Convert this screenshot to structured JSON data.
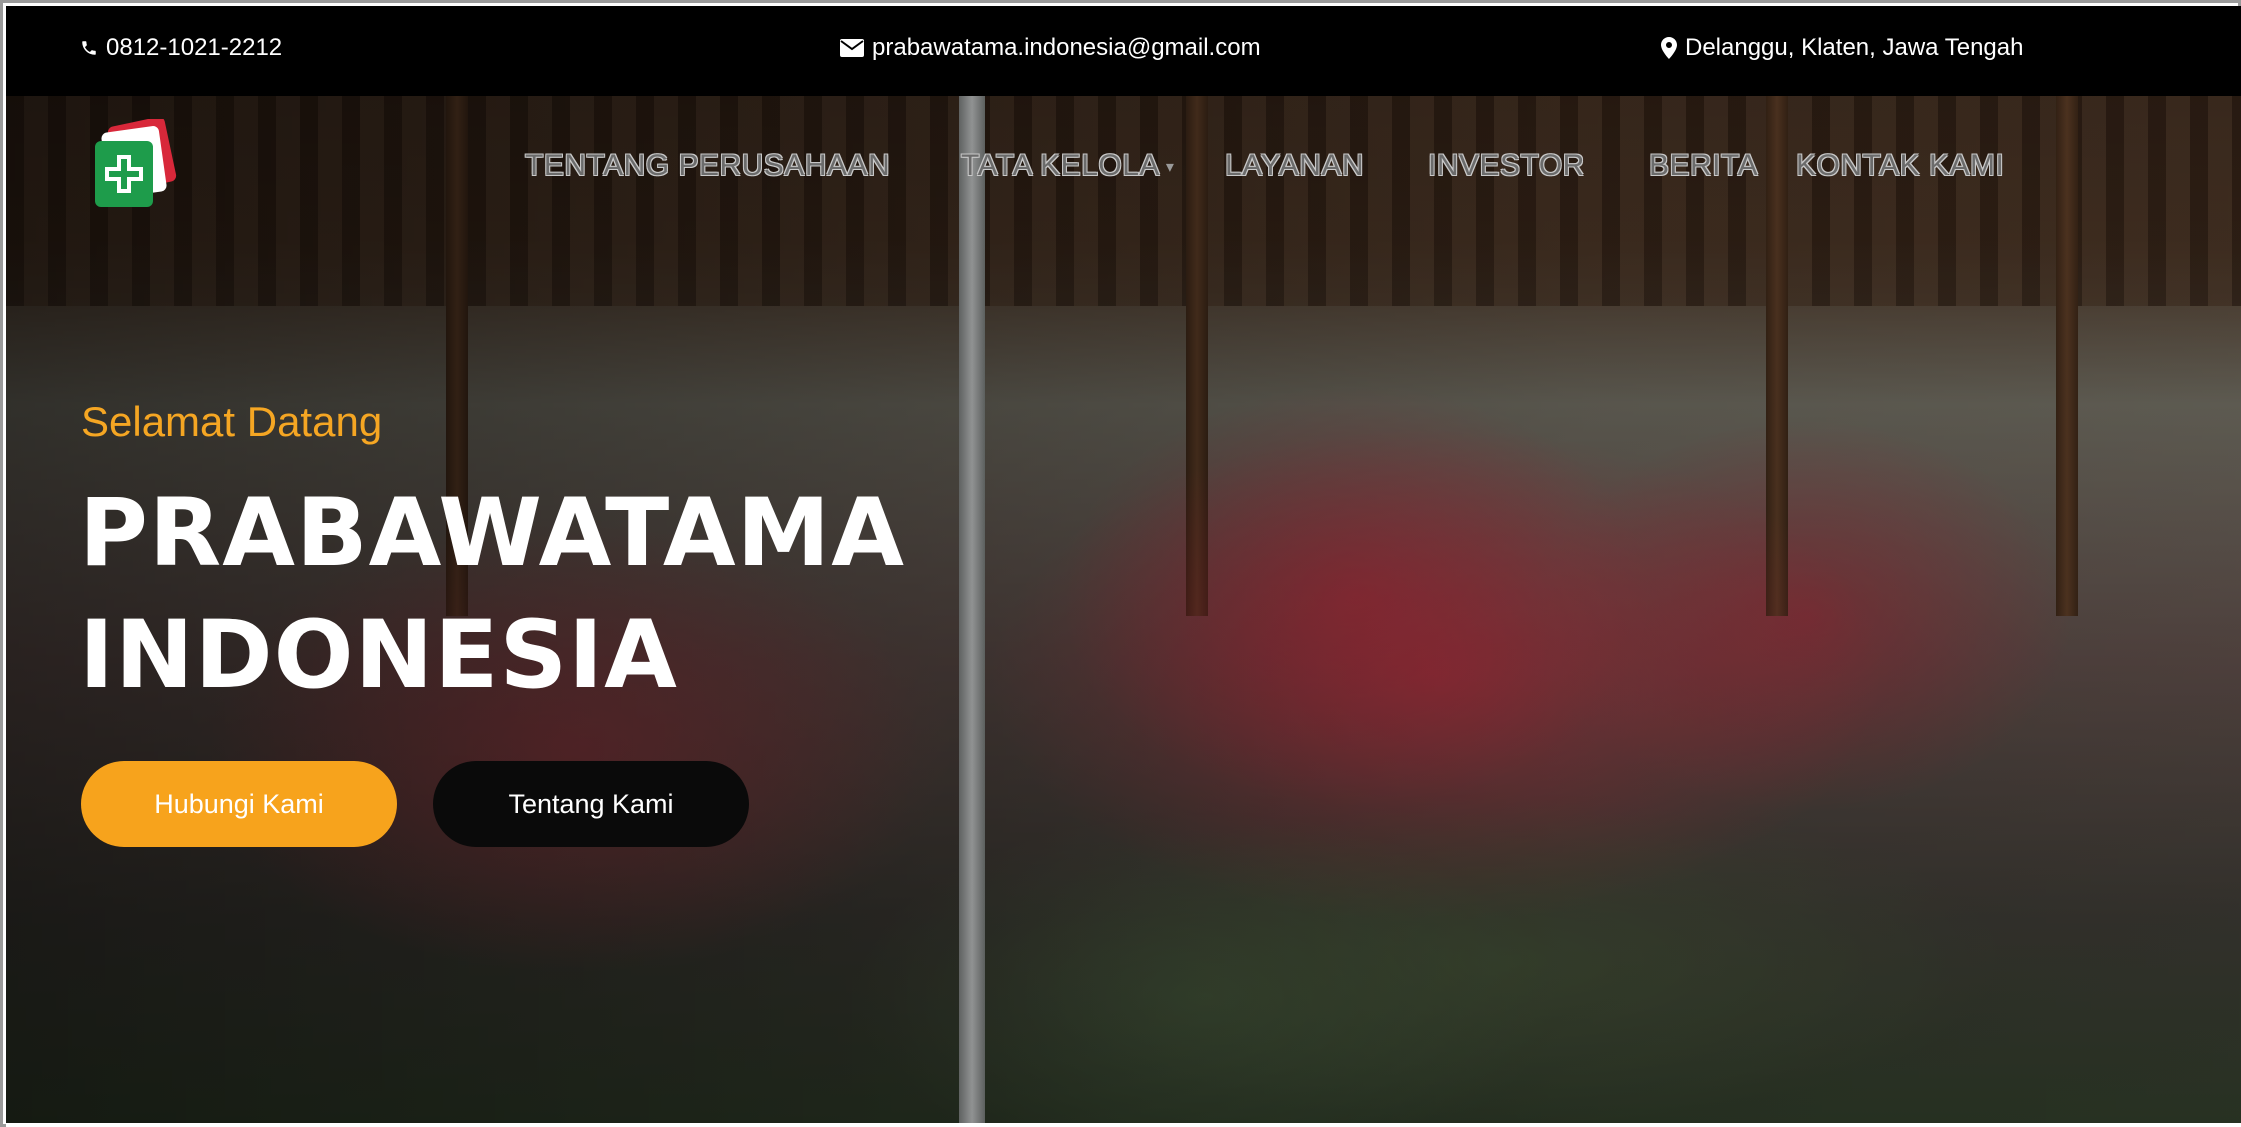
{
  "topbar": {
    "phone": "0812-1021-2212",
    "email": "prabawatama.indonesia@gmail.com",
    "location": "Delanggu, Klaten, Jawa Tengah"
  },
  "nav": {
    "items": [
      {
        "label": "TENTANG PERUSAHAAN"
      },
      {
        "label": "TATA KELOLA"
      },
      {
        "label": "LAYANAN"
      },
      {
        "label": "INVESTOR"
      },
      {
        "label": "BERITA"
      },
      {
        "label": "KONTAK KAMI"
      }
    ]
  },
  "hero": {
    "welcome": "Selamat Datang",
    "title_line1": "PRABAWATAMA",
    "title_line2": "INDONESIA",
    "primary_button": "Hubungi Kami",
    "secondary_button": "Tentang Kami"
  },
  "icons": {
    "phone": "phone-icon",
    "email": "envelope-icon",
    "location": "map-marker-icon",
    "logo": "company-logo"
  },
  "colors": {
    "accent": "#f7a31c",
    "topbar_bg": "#000000",
    "welcome_text": "#f5a623",
    "logo_green": "#1e9c4b",
    "logo_red": "#d8283a"
  }
}
